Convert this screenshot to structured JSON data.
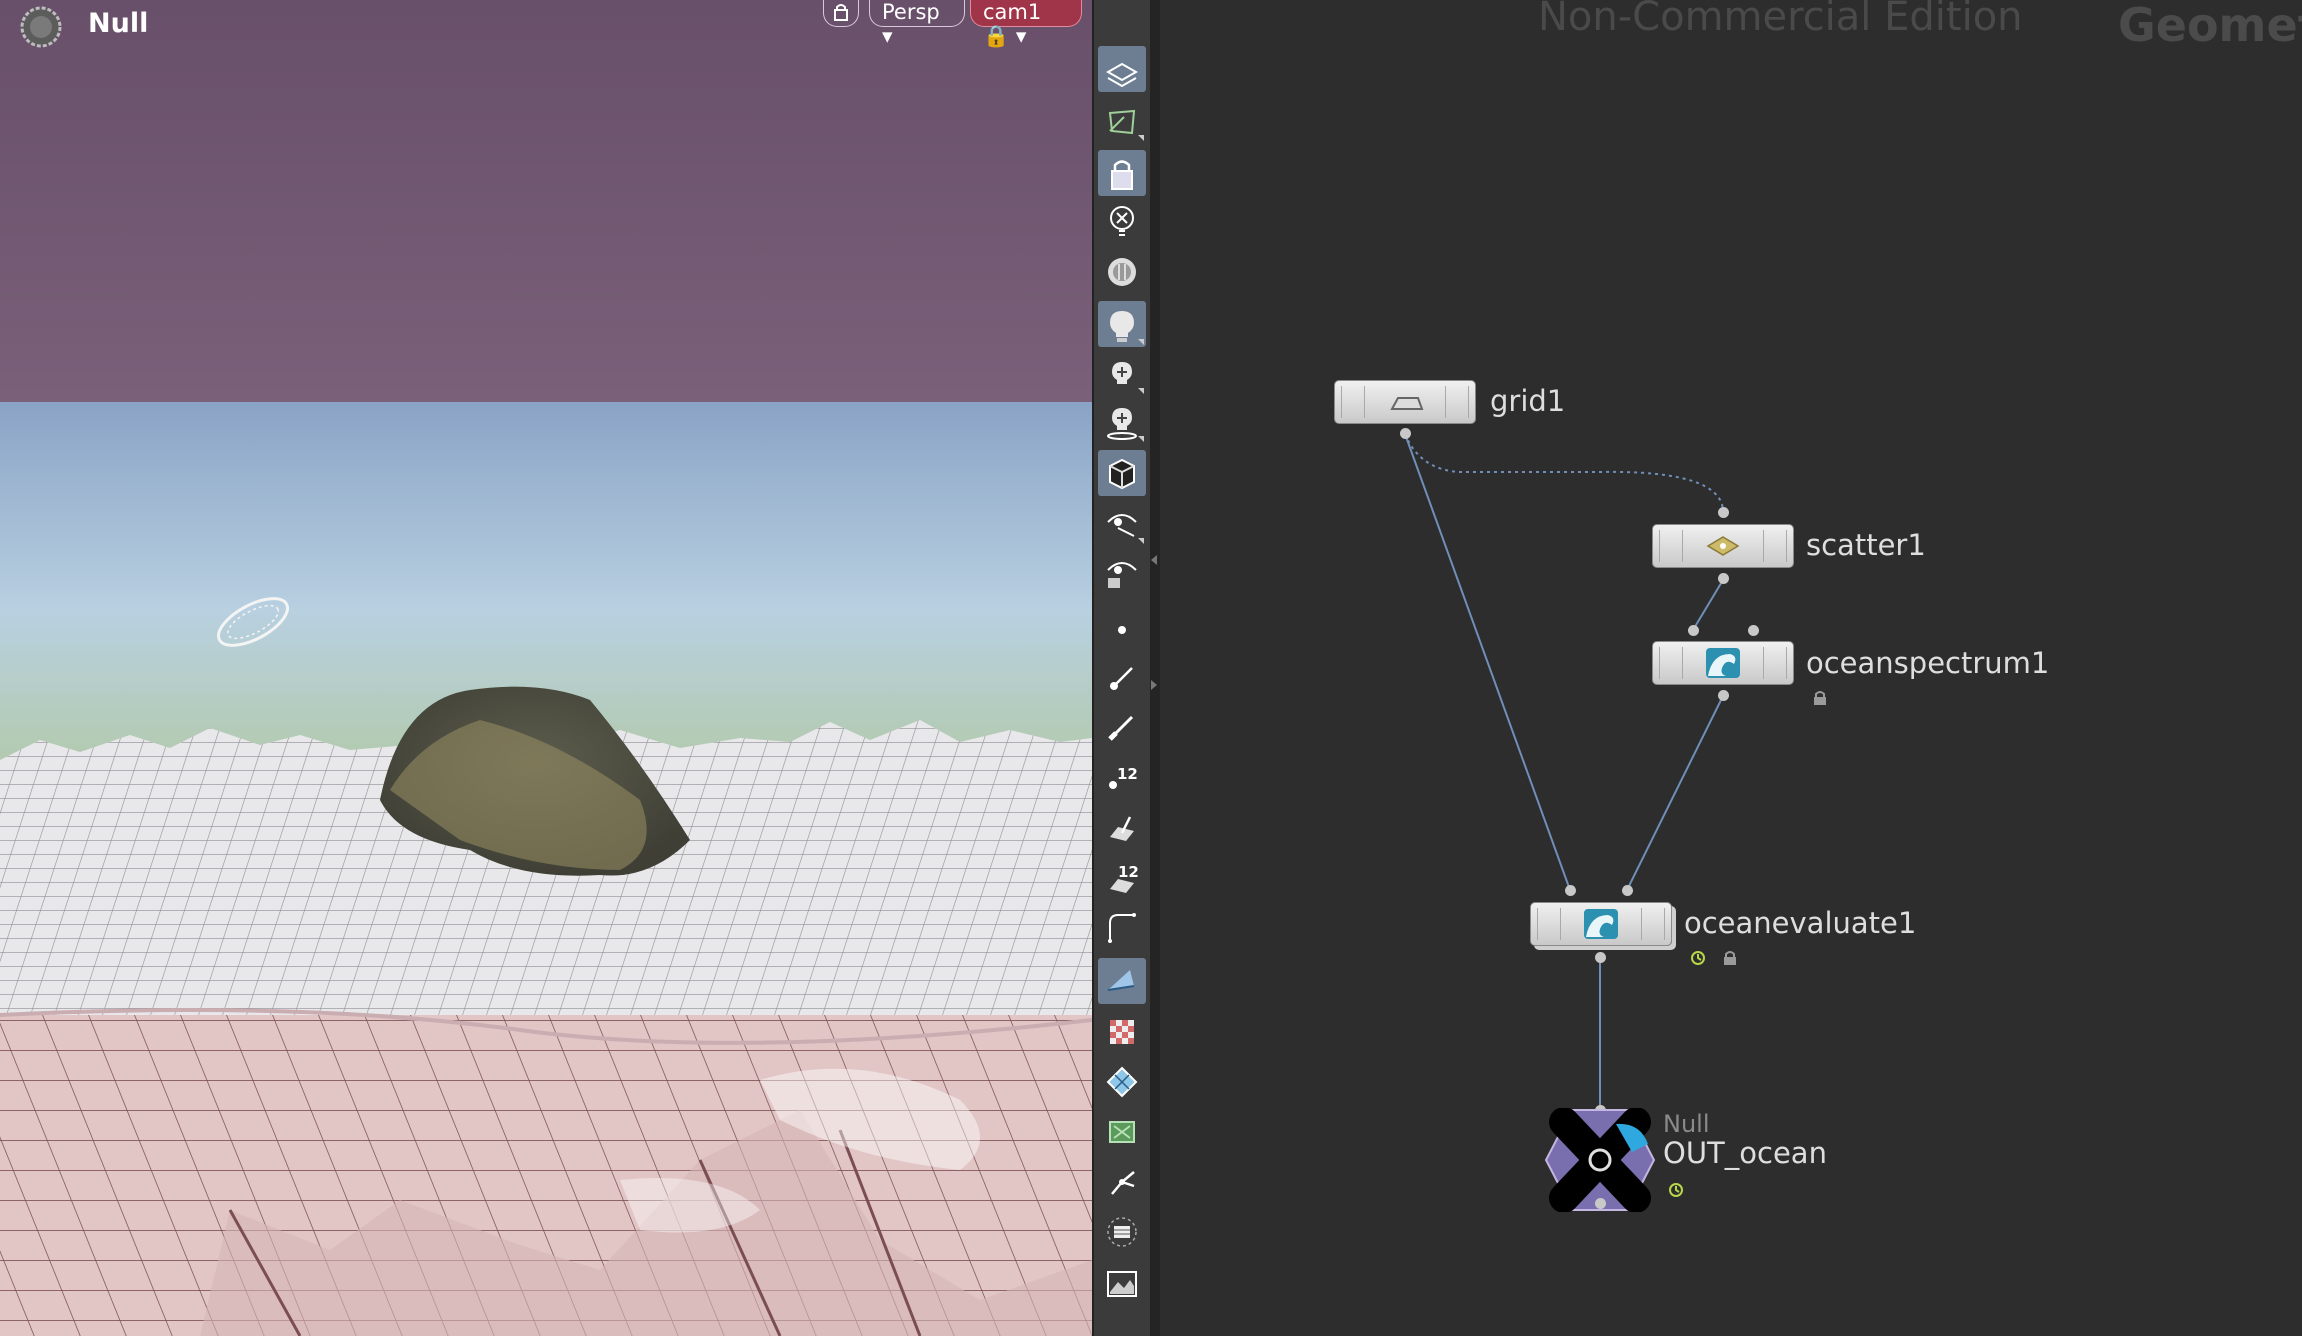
{
  "viewport": {
    "title": "Null",
    "view_label": "Persp",
    "camera_label": "cam1",
    "icons": [
      "sop-gear-icon",
      "lock-icon",
      "chevron-down-icon"
    ]
  },
  "toolbar": {
    "buttons": [
      {
        "name": "ghost-geometry-icon",
        "active": true
      },
      {
        "name": "template-geometry-icon",
        "active": false
      },
      {
        "name": "lock-camera-icon",
        "active": true
      },
      {
        "name": "remove-light-icon",
        "active": false
      },
      {
        "name": "headlight-icon",
        "active": false
      },
      {
        "name": "normal-lighting-icon",
        "active": true
      },
      {
        "name": "high-quality-lighting-icon",
        "active": false
      },
      {
        "name": "high-quality-lighting-shadows-icon",
        "active": false
      },
      {
        "name": "shading-mode-icon",
        "active": true
      },
      {
        "name": "visualizer-icon",
        "active": false
      },
      {
        "name": "visualizer-render-icon",
        "active": false
      },
      {
        "name": "display-points-icon",
        "active": false
      },
      {
        "name": "point-normals-icon",
        "active": false
      },
      {
        "name": "vertex-normals-icon",
        "active": false
      },
      {
        "name": "point-numbers-icon",
        "active": false
      },
      {
        "name": "primitive-normals-icon",
        "active": false
      },
      {
        "name": "primitive-numbers-icon",
        "active": false
      },
      {
        "name": "hull-icon",
        "active": false
      },
      {
        "name": "uv-display-icon",
        "active": true
      },
      {
        "name": "uv-checker-icon",
        "active": false
      },
      {
        "name": "uv-grid-icon",
        "active": false
      },
      {
        "name": "texture-uv-icon",
        "active": false
      },
      {
        "name": "handle-icon",
        "active": false
      },
      {
        "name": "frame-selected-icon",
        "active": false
      },
      {
        "name": "background-image-icon",
        "active": false
      }
    ],
    "point_number_label": "12",
    "primitive_number_label": "12"
  },
  "network": {
    "watermark": "Non-Commercial Edition",
    "context_label": "Geometr",
    "nodes": [
      {
        "name": "grid1",
        "type_icon": "grid-icon"
      },
      {
        "name": "scatter1",
        "type_icon": "scatter-icon"
      },
      {
        "name": "oceanspectrum1",
        "type_icon": "ocean-wave-icon",
        "locked": true
      },
      {
        "name": "oceanevaluate1",
        "type_icon": "ocean-wave-icon",
        "locked": true,
        "time_dependent": true
      },
      {
        "name": "OUT_ocean",
        "type": "Null",
        "type_icon": "null-node-icon",
        "time_dependent": true
      }
    ]
  },
  "colors": {
    "sky_top": "#6b5672",
    "sky_horizon": "#b4cad8",
    "ocean_grid": "#e9eaec",
    "ground": "#dcbcbc",
    "network_bg": "#2d2d2d",
    "toolbar_active": "#6d7d92",
    "camera_pill": "#a03448",
    "wire": "#6f8fb8"
  }
}
